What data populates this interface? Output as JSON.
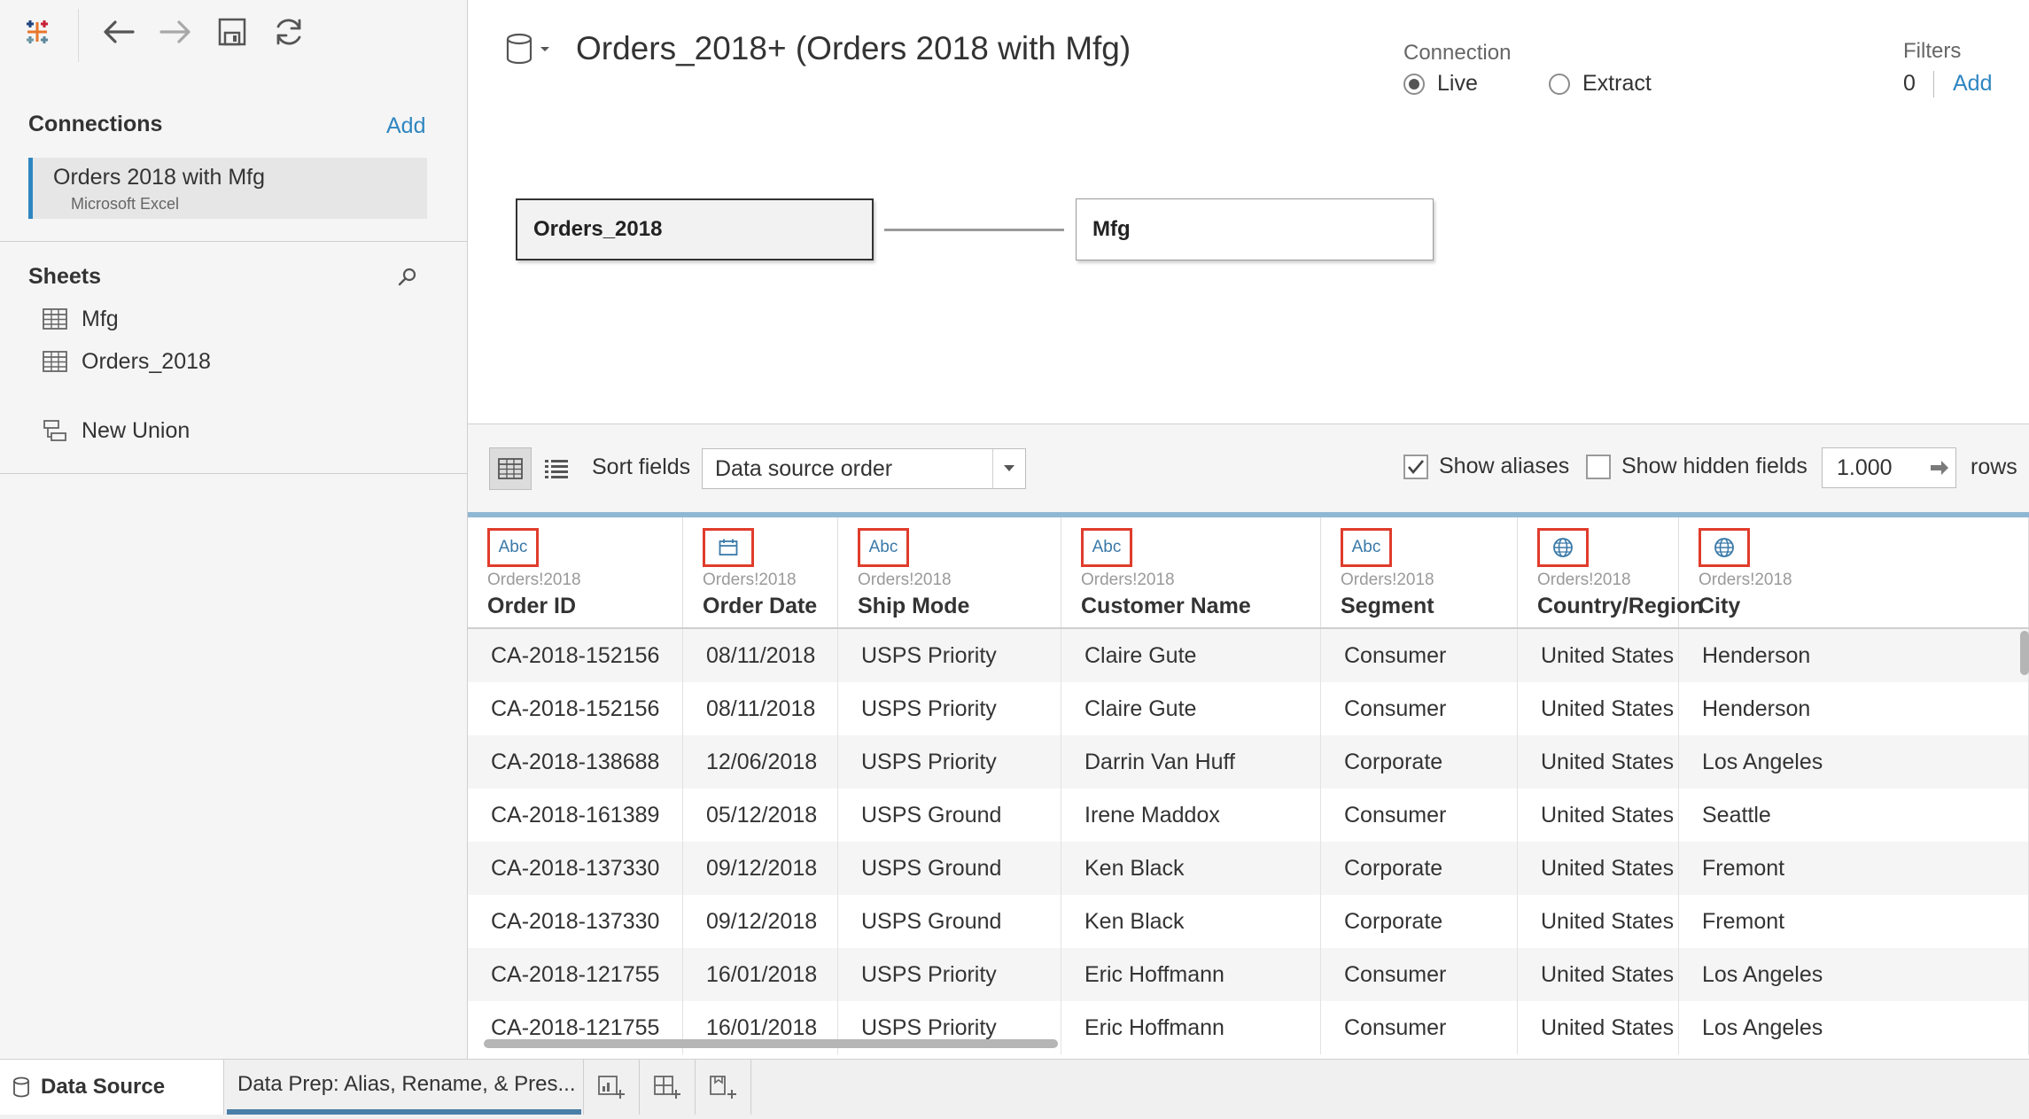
{
  "toolbar": {
    "icons": [
      "tableau-logo-icon",
      "back-arrow-icon",
      "forward-arrow-icon",
      "save-icon",
      "refresh-icon"
    ]
  },
  "connections": {
    "title": "Connections",
    "add_label": "Add",
    "items": [
      {
        "name": "Orders 2018 with Mfg",
        "type": "Microsoft Excel"
      }
    ]
  },
  "sheets": {
    "title": "Sheets",
    "items": [
      {
        "label": "Mfg"
      },
      {
        "label": "Orders_2018"
      }
    ],
    "new_union_label": "New Union"
  },
  "datasource": {
    "title": "Orders_2018+ (Orders 2018 with Mfg)",
    "connection": {
      "label": "Connection",
      "live_label": "Live",
      "extract_label": "Extract",
      "selected": "Live"
    },
    "filters": {
      "label": "Filters",
      "count": "0",
      "add_label": "Add"
    },
    "tables": [
      {
        "name": "Orders_2018",
        "selected": true
      },
      {
        "name": "Mfg",
        "selected": false
      }
    ]
  },
  "grid_toolbar": {
    "sort_label": "Sort fields",
    "sort_value": "Data source order",
    "show_aliases_label": "Show aliases",
    "show_aliases_checked": true,
    "show_hidden_label": "Show hidden fields",
    "show_hidden_checked": false,
    "rows_value": "1.000",
    "rows_label": "rows"
  },
  "grid": {
    "columns": [
      {
        "type": "Abc",
        "type_icon": "string-type-icon",
        "source": "Orders!2018",
        "name": "Order ID"
      },
      {
        "type": "",
        "type_icon": "date-type-icon",
        "source": "Orders!2018",
        "name": "Order Date"
      },
      {
        "type": "Abc",
        "type_icon": "string-type-icon",
        "source": "Orders!2018",
        "name": "Ship Mode"
      },
      {
        "type": "Abc",
        "type_icon": "string-type-icon",
        "source": "Orders!2018",
        "name": "Customer Name"
      },
      {
        "type": "Abc",
        "type_icon": "string-type-icon",
        "source": "Orders!2018",
        "name": "Segment"
      },
      {
        "type": "",
        "type_icon": "geographic-type-icon",
        "source": "Orders!2018",
        "name": "Country/Region"
      },
      {
        "type": "",
        "type_icon": "geographic-type-icon",
        "source": "Orders!2018",
        "name": "City"
      }
    ],
    "rows": [
      [
        "CA-2018-152156",
        "08/11/2018",
        "USPS Priority",
        "Claire Gute",
        "Consumer",
        "United States",
        "Henderson"
      ],
      [
        "CA-2018-152156",
        "08/11/2018",
        "USPS Priority",
        "Claire Gute",
        "Consumer",
        "United States",
        "Henderson"
      ],
      [
        "CA-2018-138688",
        "12/06/2018",
        "USPS Priority",
        "Darrin Van Huff",
        "Corporate",
        "United States",
        "Los Angeles"
      ],
      [
        "CA-2018-161389",
        "05/12/2018",
        "USPS Ground",
        "Irene Maddox",
        "Consumer",
        "United States",
        "Seattle"
      ],
      [
        "CA-2018-137330",
        "09/12/2018",
        "USPS Ground",
        "Ken Black",
        "Corporate",
        "United States",
        "Fremont"
      ],
      [
        "CA-2018-137330",
        "09/12/2018",
        "USPS Ground",
        "Ken Black",
        "Corporate",
        "United States",
        "Fremont"
      ],
      [
        "CA-2018-121755",
        "16/01/2018",
        "USPS Priority",
        "Eric Hoffmann",
        "Consumer",
        "United States",
        "Los Angeles"
      ],
      [
        "CA-2018-121755",
        "16/01/2018",
        "USPS Priority",
        "Eric Hoffmann",
        "Consumer",
        "United States",
        "Los Angeles"
      ]
    ]
  },
  "tabs": {
    "data_source_label": "Data Source",
    "sheet_label": "Data Prep: Alias, Rename, & Pres...",
    "buttons": [
      "new-worksheet-icon",
      "new-dashboard-icon",
      "new-story-icon"
    ]
  },
  "colors": {
    "accent": "#2f86c1",
    "highlight_box": "#e03c2c",
    "type_icon": "#3a79a8"
  }
}
